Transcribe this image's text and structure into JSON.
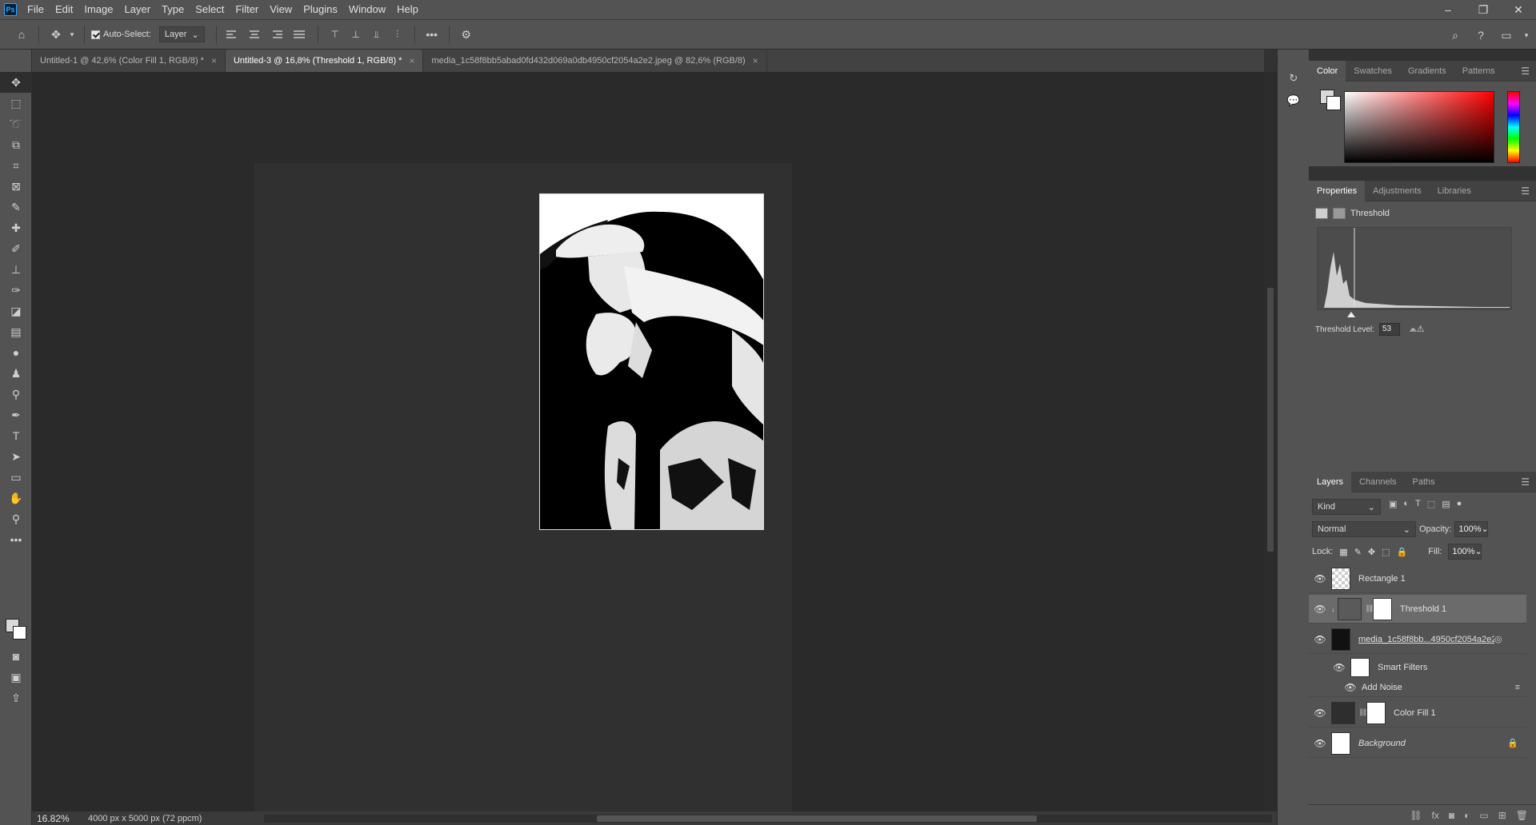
{
  "menubar": {
    "logo": "Ps",
    "items": [
      "File",
      "Edit",
      "Image",
      "Layer",
      "Type",
      "Select",
      "Filter",
      "View",
      "Plugins",
      "Window",
      "Help"
    ],
    "controls": [
      "–",
      "❐",
      "✕"
    ]
  },
  "options": {
    "auto_select_label": "Auto-Select:",
    "auto_select_value": "Layer"
  },
  "tabs": [
    {
      "label": "Untitled-1 @ 42,6% (Color Fill 1, RGB/8) *"
    },
    {
      "label": "Untitled-3 @ 16,8% (Threshold 1, RGB/8) *"
    },
    {
      "label": "media_1c58f8bb5abad0fd432d069a0db4950cf2054a2e2.jpeg @ 82,6% (RGB/8)"
    }
  ],
  "status": {
    "zoom": "16.82%",
    "doc_info": "4000 px x 5000 px (72 ppcm)"
  },
  "color_panel": {
    "tabs": [
      "Color",
      "Swatches",
      "Gradients",
      "Patterns"
    ]
  },
  "properties_panel": {
    "tabs": [
      "Properties",
      "Adjustments",
      "Libraries"
    ],
    "title": "Threshold",
    "threshold_label": "Threshold Level:",
    "threshold_value": "53"
  },
  "layers_panel": {
    "tabs": [
      "Layers",
      "Channels",
      "Paths"
    ],
    "kind_label": "Kind",
    "blend_mode": "Normal",
    "opacity_label": "Opacity:",
    "opacity_value": "100%",
    "lock_label": "Lock:",
    "fill_label": "Fill:",
    "fill_value": "100%",
    "layers": [
      {
        "name": "Rectangle 1"
      },
      {
        "name": "Threshold 1"
      },
      {
        "name": "media_1c58f8bb...4950cf2054a2e2..."
      },
      {
        "name": "Smart Filters"
      },
      {
        "name": "Add Noise"
      },
      {
        "name": "Color Fill 1"
      },
      {
        "name": "Background"
      }
    ]
  },
  "colors": {
    "ui_bg": "#535353",
    "canvas_bg": "#2a2a2a",
    "accent": "#31a8ff"
  }
}
